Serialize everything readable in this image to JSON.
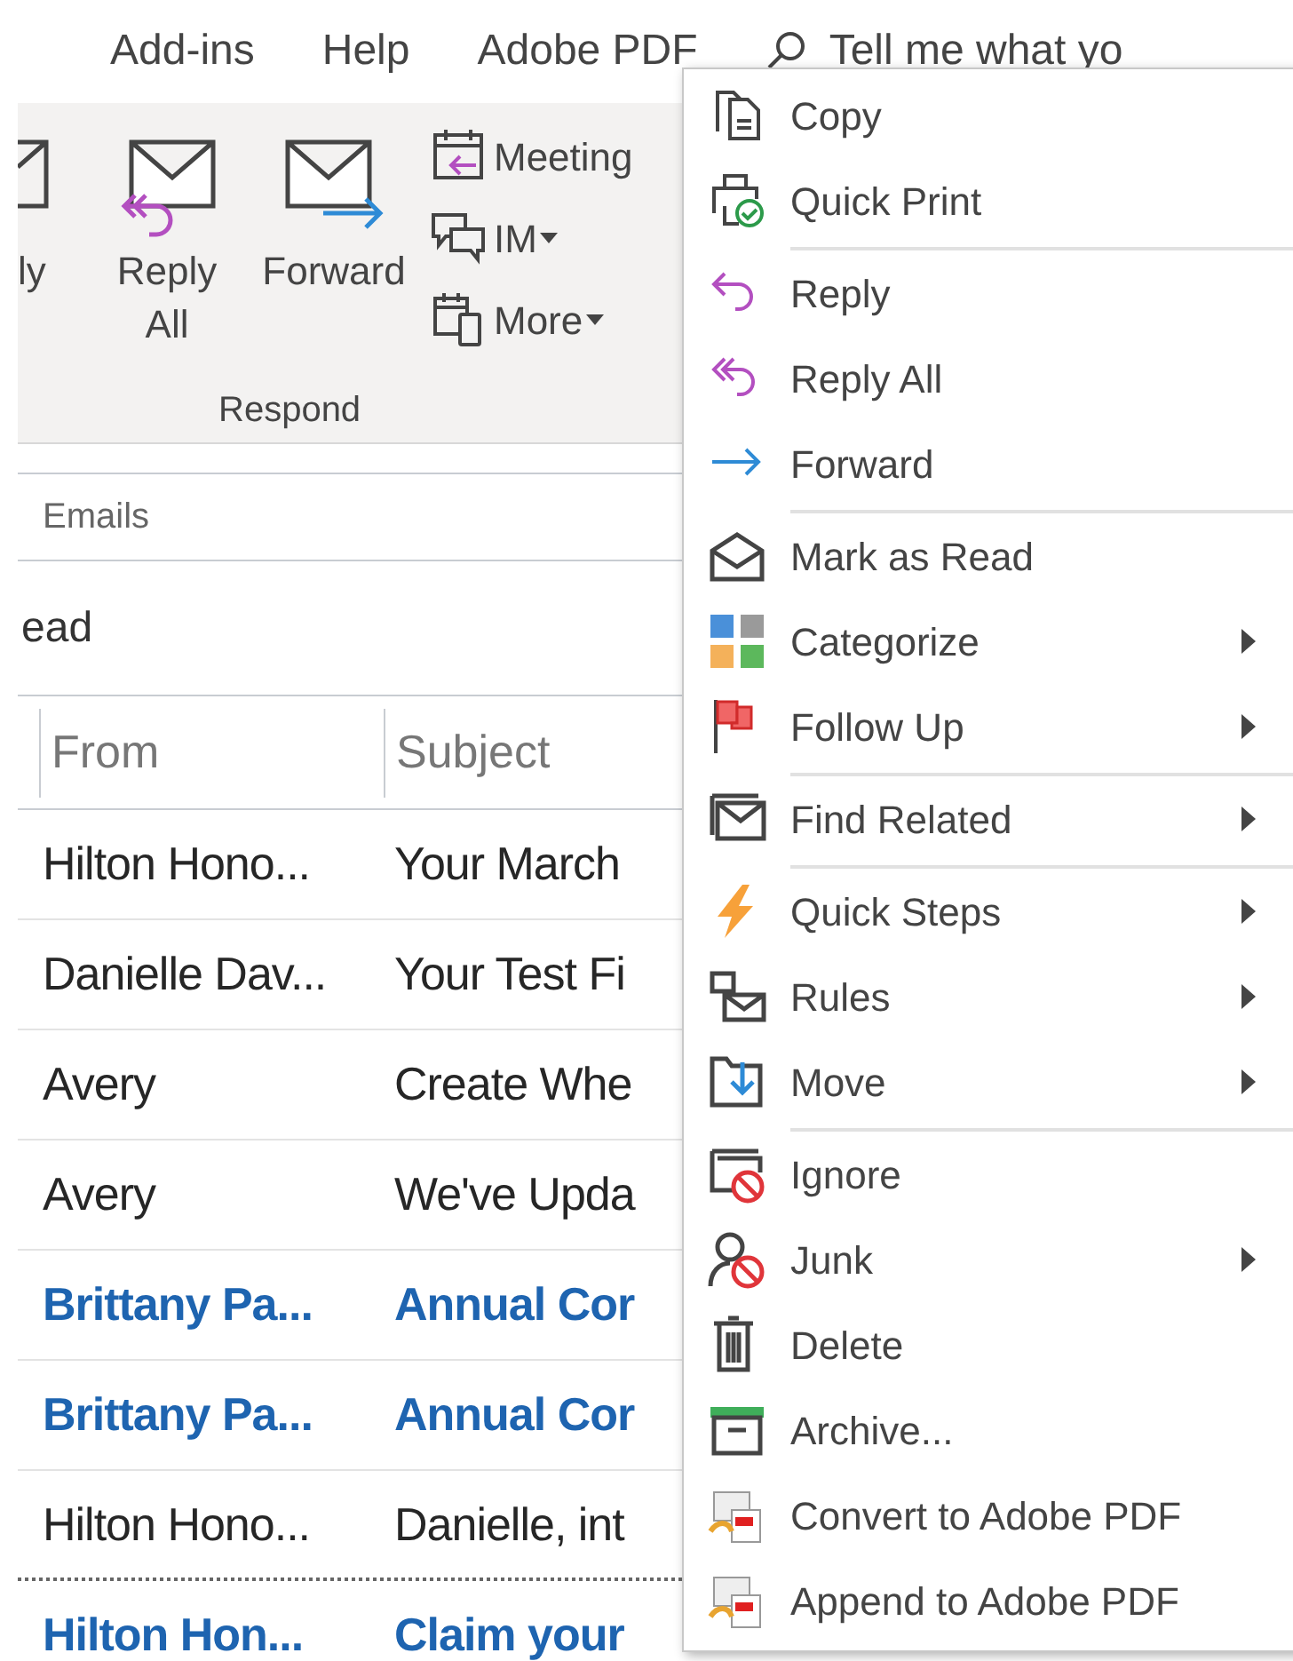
{
  "ribbon": {
    "tabs": [
      "Add-ins",
      "Help",
      "Adobe PDF"
    ],
    "tell_me": "Tell me what yo",
    "partial_button": "ly",
    "large_buttons": [
      {
        "kind": "replyall",
        "label": "Reply All"
      },
      {
        "kind": "forward",
        "label": "Forward"
      }
    ],
    "small_buttons": [
      {
        "kind": "meeting",
        "label": "Meeting",
        "dropdown": false
      },
      {
        "kind": "im",
        "label": "IM",
        "dropdown": true
      },
      {
        "kind": "more",
        "label": "More",
        "dropdown": true
      }
    ],
    "group_label": "Respond"
  },
  "search_scope": "Emails",
  "filter": "ead",
  "columns": [
    "From",
    "Subject"
  ],
  "rows": [
    {
      "from": "Hilton Hono...",
      "subject": "Your March",
      "unread": false,
      "dotted": false
    },
    {
      "from": "Danielle Dav...",
      "subject": "Your Test Fi",
      "unread": false,
      "dotted": false
    },
    {
      "from": "Avery",
      "subject": "Create Whe",
      "unread": false,
      "dotted": false
    },
    {
      "from": "Avery",
      "subject": "We've Upda",
      "unread": false,
      "dotted": false
    },
    {
      "from": "Brittany Pa...",
      "subject": "Annual Cor",
      "unread": true,
      "dotted": false
    },
    {
      "from": "Brittany Pa...",
      "subject": "Annual Cor",
      "unread": true,
      "dotted": false
    },
    {
      "from": "Hilton Hono...",
      "subject": "Danielle, int",
      "unread": false,
      "dotted": true
    },
    {
      "from": "Hilton Hon...",
      "subject": "Claim your",
      "unread": true,
      "dotted": false
    }
  ],
  "context_menu": [
    [
      {
        "kind": "copy",
        "label": "Copy",
        "submenu": false
      },
      {
        "kind": "print",
        "label": "Quick Print",
        "submenu": false
      }
    ],
    [
      {
        "kind": "reply",
        "label": "Reply",
        "submenu": false
      },
      {
        "kind": "replyall",
        "label": "Reply All",
        "submenu": false
      },
      {
        "kind": "forward",
        "label": "Forward",
        "submenu": false
      }
    ],
    [
      {
        "kind": "read",
        "label": "Mark as Read",
        "submenu": false
      },
      {
        "kind": "categorize",
        "label": "Categorize",
        "submenu": true
      },
      {
        "kind": "flag",
        "label": "Follow Up",
        "submenu": true
      }
    ],
    [
      {
        "kind": "find",
        "label": "Find Related",
        "submenu": true
      }
    ],
    [
      {
        "kind": "steps",
        "label": "Quick Steps",
        "submenu": true
      },
      {
        "kind": "rules",
        "label": "Rules",
        "submenu": true
      },
      {
        "kind": "move",
        "label": "Move",
        "submenu": true
      }
    ],
    [
      {
        "kind": "ignore",
        "label": "Ignore",
        "submenu": false
      },
      {
        "kind": "junk",
        "label": "Junk",
        "submenu": true
      },
      {
        "kind": "delete",
        "label": "Delete",
        "submenu": false
      },
      {
        "kind": "archive",
        "label": "Archive...",
        "submenu": false
      },
      {
        "kind": "pdf",
        "label": "Convert to Adobe PDF",
        "submenu": false
      },
      {
        "kind": "pdf",
        "label": "Append to Adobe PDF",
        "submenu": false
      }
    ]
  ]
}
